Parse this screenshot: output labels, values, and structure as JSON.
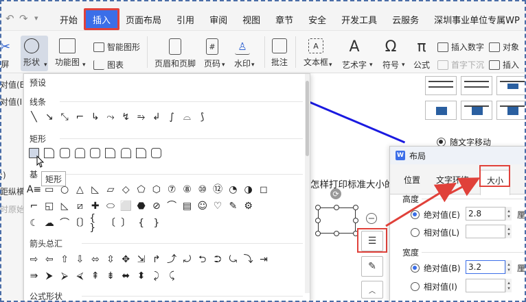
{
  "menubar": {
    "tabs": [
      "开始",
      "插入",
      "页面布局",
      "引用",
      "审阅",
      "视图",
      "章节",
      "安全",
      "开发工具",
      "云服务",
      "深圳事业单位专属WP"
    ],
    "active_tab": "插入"
  },
  "toolbar": {
    "left_partial_label": "屏",
    "shape_label": "形状",
    "function_label": "功能图",
    "smart_label": "智能图形",
    "chart_label": "图表",
    "header_footer_label": "页眉和页脚",
    "page_number_label": "页码",
    "watermark_label": "水印",
    "comment_label": "批注",
    "textbox_label": "文本框",
    "arttext_label": "艺术字",
    "symbol_label": "符号",
    "formula_label": "公式",
    "insert_number_label": "插入数字",
    "object_label": "对象",
    "dropcap_label": "首字下沉",
    "insert_partial_label": "插入"
  },
  "left_panel": {
    "items": [
      "对值(E",
      "对值(I",
      ":)",
      "距纵横",
      "时原始"
    ]
  },
  "dropdown": {
    "header": "预设",
    "sections": {
      "lines": "线条",
      "rect": "矩形",
      "basic": "基",
      "arrows": "箭头总汇",
      "formula": "公式形状"
    },
    "line_glyphs": [
      "╲",
      "↘",
      "⤡",
      "⌐",
      "↳",
      "⤳",
      "↯",
      "⥱",
      "↲",
      "∫",
      "⌓",
      "⟆"
    ],
    "rect_count": 9,
    "basic_row1": [
      "A≡",
      "▭",
      "○",
      "△",
      "◺",
      "▱",
      "◇",
      "⬠",
      "⬡",
      "⑦",
      "⑧",
      "⑩",
      "⑫",
      "◔",
      "◑",
      "◻"
    ],
    "basic_row2": [
      "⌐",
      "◱",
      "◺",
      "⧄",
      "✚",
      "⬭",
      "⬜",
      "⬣",
      "⊘",
      "⌒",
      "▤",
      "☺",
      "♡",
      "✎",
      "⚙"
    ],
    "basic_row3": [
      "☾",
      "☁",
      "⌒",
      "〔〕",
      "{ }",
      "〔",
      "〕",
      "{",
      "}"
    ],
    "arrow_row1": [
      "⇨",
      "⇦",
      "⇧",
      "⇩",
      "⬄",
      "⇳",
      "✥",
      "⇲",
      "↱",
      "⤴",
      "⤾",
      "⮌",
      "⮊",
      "⤿",
      "⤵",
      "⇥"
    ],
    "arrow_row2": [
      "⇛",
      "⮞",
      "⮚",
      "⮘",
      "⇞",
      "⇟",
      "⬌",
      "⬍",
      "⤸",
      "⤹"
    ],
    "tooltip": "矩形"
  },
  "document": {
    "text": "怎样打印标准大小的"
  },
  "wrap_panel": {
    "move_with_text": "随文字移动"
  },
  "layout_dialog": {
    "title": "布局",
    "tabs": [
      "位置",
      "文字环绕",
      "大小"
    ],
    "active_tab": "大小",
    "height_section": "高度",
    "height_absolute_label": "绝对值(E)",
    "height_absolute_value": "2.8",
    "height_relative_label": "相对值(L)",
    "width_section": "宽度",
    "width_absolute_label": "绝对值(B)",
    "width_absolute_value": "3.2",
    "width_relative_label": "相对值(I)",
    "unit_partial": "厘"
  },
  "colors": {
    "accent": "#3b6ee8",
    "highlight_red": "#e0413a",
    "doc_line_blue": "#1a1ae0"
  }
}
